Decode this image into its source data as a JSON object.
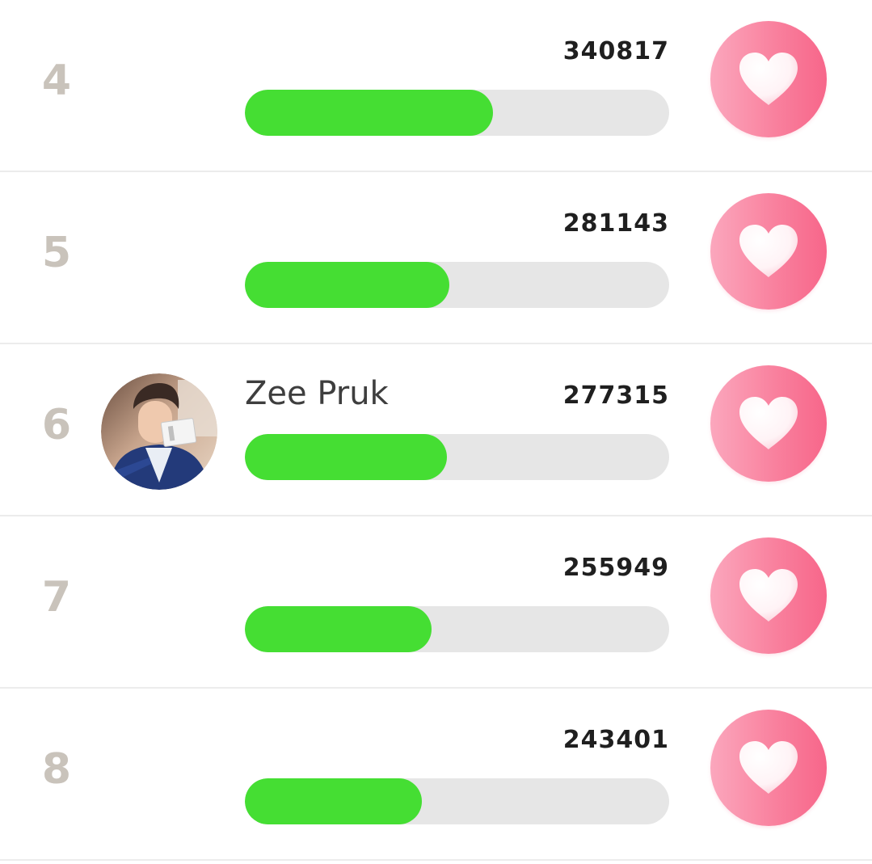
{
  "ranking": {
    "rows": [
      {
        "rank": "4",
        "name": "",
        "votes": "340817",
        "progress": 0.585,
        "has_avatar": false
      },
      {
        "rank": "5",
        "name": "",
        "votes": "281143",
        "progress": 0.482,
        "has_avatar": false
      },
      {
        "rank": "6",
        "name": "Zee Pruk",
        "votes": "277315",
        "progress": 0.476,
        "has_avatar": true
      },
      {
        "rank": "7",
        "name": "",
        "votes": "255949",
        "progress": 0.44,
        "has_avatar": false
      },
      {
        "rank": "8",
        "name": "",
        "votes": "243401",
        "progress": 0.418,
        "has_avatar": false
      }
    ]
  },
  "icons": {
    "vote": "heart-icon",
    "avatar": "avatar-photo"
  },
  "colors": {
    "progress_fill": "#45de33",
    "progress_track": "#e6e6e6",
    "rank_text": "#c9c3bb",
    "vote_button": "#f9819e",
    "heart": "#ffffff"
  }
}
